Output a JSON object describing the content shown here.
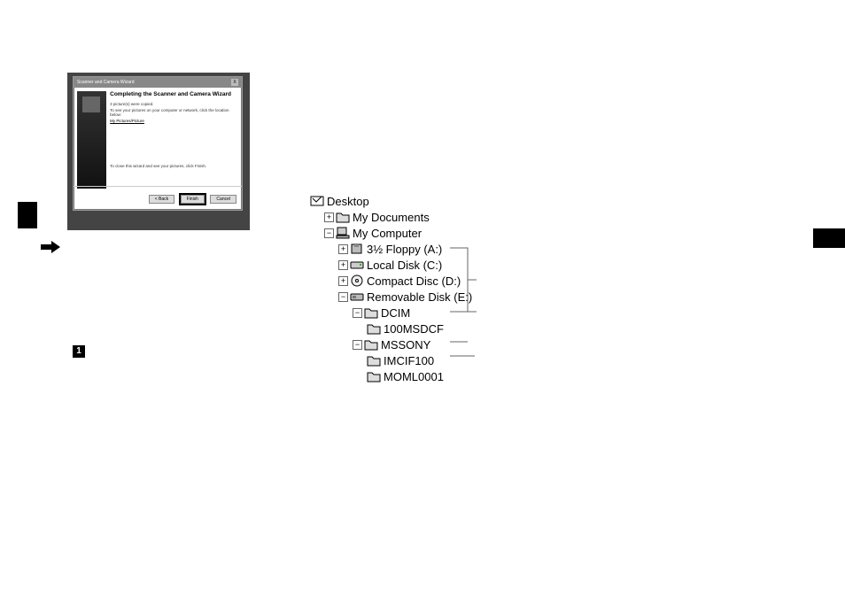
{
  "wizard": {
    "titlebar": "Scanner and Camera Wizard",
    "heading": "Completing the Scanner and Camera Wizard",
    "line1": "3 picture(s) were copied.",
    "line2": "To see your pictures on your computer or network, click the location below:",
    "link": "My Pictures/Picture",
    "footer_note": "To close this wizard and see your pictures, click Finish.",
    "btn_back": "< Back",
    "btn_finish": "Finish",
    "btn_cancel": "Cancel",
    "close_x": "X"
  },
  "step_badge": "1",
  "tree": {
    "desktop": "Desktop",
    "my_documents": "My Documents",
    "my_computer": "My Computer",
    "floppy": "3½ Floppy (A:)",
    "local_disk": "Local Disk (C:)",
    "cd": "Compact Disc (D:)",
    "removable": "Removable Disk (E:)",
    "dcim": "DCIM",
    "100msdcf": "100MSDCF",
    "mssony": "MSSONY",
    "imcif100": "IMCIF100",
    "moml0001": "MOML0001"
  }
}
